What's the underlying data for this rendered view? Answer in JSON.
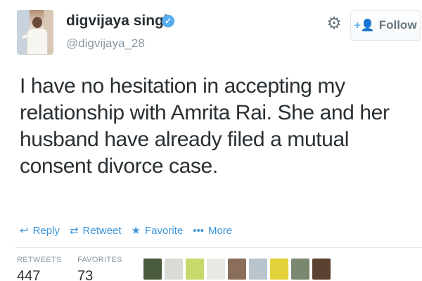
{
  "profile": {
    "name": "digvijaya singh",
    "handle": "@digvijaya_28",
    "verified": true
  },
  "toolbar": {
    "settings_icon": "gear-icon",
    "follow_label": "Follow"
  },
  "tweet": {
    "text": "I have no hesitation in accepting my relationship with Amrita Rai. She and her husband have already filed a mutual consent divorce case."
  },
  "actions": [
    {
      "label": "Reply",
      "icon": "reply-icon"
    },
    {
      "label": "Retweet",
      "icon": "retweet-icon"
    },
    {
      "label": "Favorite",
      "icon": "star-icon"
    },
    {
      "label": "More",
      "icon": "more-icon"
    }
  ],
  "stats": {
    "retweets_label": "RETWEETS",
    "retweets": "447",
    "favorites_label": "FAVORITES",
    "favorites": "73"
  },
  "colors": {
    "link": "#3b94d9",
    "verified": "#55acee",
    "text": "#292f33",
    "muted": "#8899a6"
  }
}
